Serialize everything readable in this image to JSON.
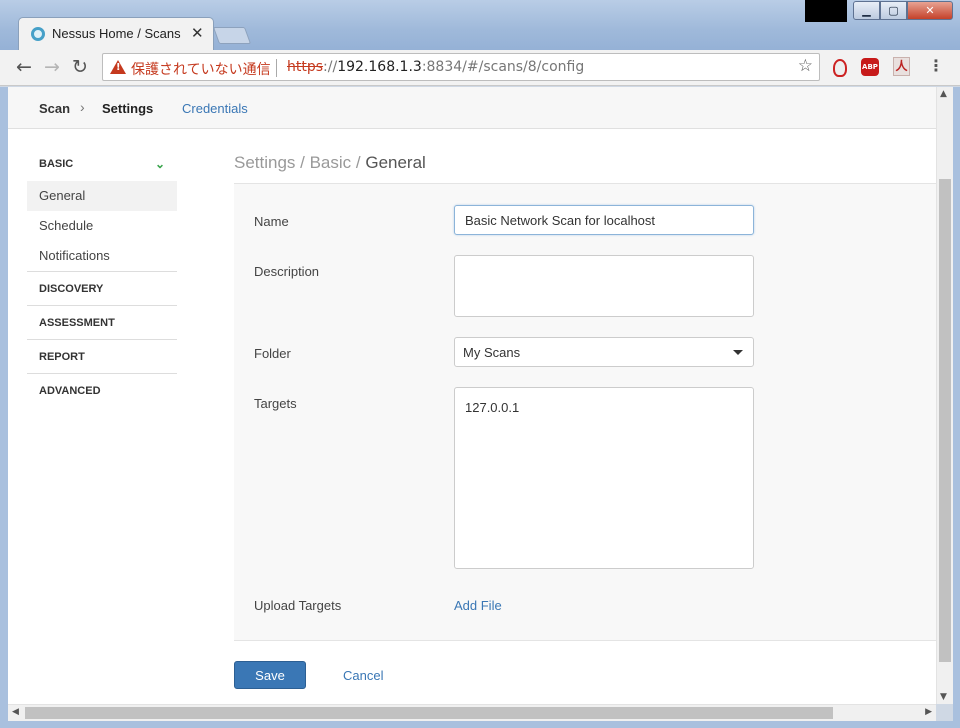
{
  "browser": {
    "tab_title": "Nessus Home / Scans",
    "tab_close": "✕",
    "window_buttons": {
      "minimize": "▁",
      "maximize": "▢",
      "close": "✕"
    },
    "nav": {
      "back": "←",
      "forward": "→",
      "reload": "↻"
    },
    "security_text": "保護されていない通信",
    "url_scheme": "https",
    "url_sep": "://",
    "url_host": "192.168.1.3",
    "url_rest": ":8834/#/scans/8/config",
    "bookmark_icon": "☆",
    "extensions": {
      "abp": "ABP",
      "pdf": "人"
    },
    "menu": "⋮"
  },
  "subnav": {
    "scan": "Scan",
    "arrow": "›",
    "settings": "Settings",
    "credentials": "Credentials"
  },
  "sidebar": {
    "basic": {
      "label": "BASIC",
      "chevron": "⌄",
      "items": [
        "General",
        "Schedule",
        "Notifications"
      ]
    },
    "sections": [
      "DISCOVERY",
      "ASSESSMENT",
      "REPORT",
      "ADVANCED"
    ]
  },
  "section_path": {
    "prefix": "Settings / Basic / ",
    "current": "General"
  },
  "form": {
    "name_label": "Name",
    "name_value": "Basic Network Scan for localhost",
    "description_label": "Description",
    "description_value": "",
    "folder_label": "Folder",
    "folder_value": "My Scans",
    "targets_label": "Targets",
    "targets_value": "127.0.0.1",
    "upload_label": "Upload Targets",
    "upload_link": "Add File"
  },
  "actions": {
    "save": "Save",
    "cancel": "Cancel"
  },
  "scroll": {
    "up": "▲",
    "down": "▼",
    "left": "◀",
    "right": "▶"
  },
  "colors": {
    "accent": "#3a77b5",
    "insecure": "#c5391e",
    "check_green": "#37a34a"
  }
}
